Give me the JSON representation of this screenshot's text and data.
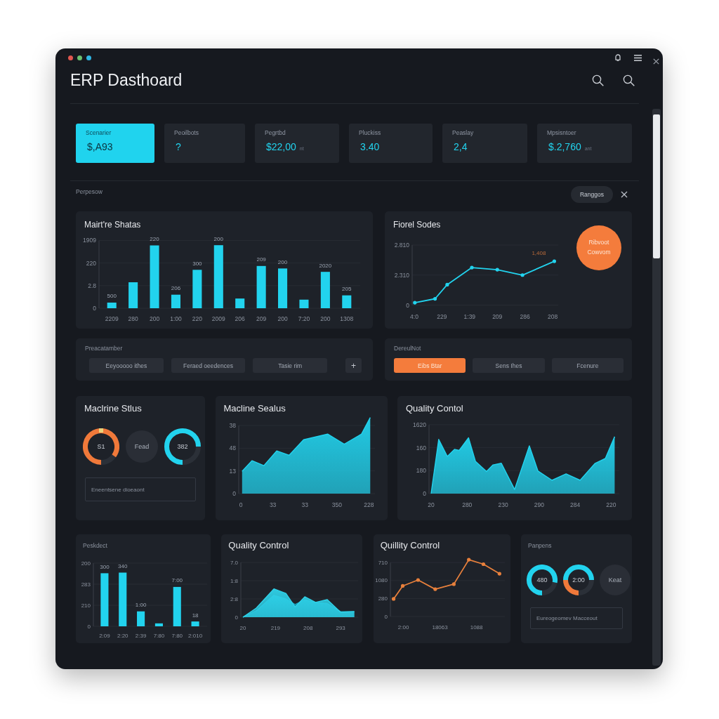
{
  "window": {
    "title": "ERP Dasthoard"
  },
  "kpi_cards": [
    {
      "label": "Scenarier",
      "value": "$,A93",
      "selected": true
    },
    {
      "label": "Peoilbots",
      "value": "?",
      "selected": false
    },
    {
      "label": "Pegrtbd",
      "value": "$22,00",
      "unit": "nt",
      "selected": false
    },
    {
      "label": "Pluckiss",
      "value": "3.40",
      "selected": false
    },
    {
      "label": "Peaslay",
      "value": "2,4",
      "selected": false
    },
    {
      "label": "Mpsisntoer",
      "value": "$.2,760",
      "unit": "ant",
      "selected": false
    }
  ],
  "section": {
    "label": "Perpesow",
    "button": "Ranggos"
  },
  "rows": [
    [
      {
        "kind": "chart",
        "title": "Mairt're Shatas",
        "chart": {
          "y_labels": [
            "1909",
            "220",
            "2.8",
            "0"
          ],
          "x_labels": [
            "2209",
            "280",
            "200",
            "1:00",
            "220",
            "2009",
            "206",
            "209",
            "200",
            "7:20",
            "200",
            "1308"
          ],
          "value_labels": [
            "500",
            "220",
            "206",
            "300",
            "200",
            "209",
            "200",
            "2020",
            "205"
          ]
        }
      },
      {
        "kind": "chart",
        "title": "Fiorel Sodes",
        "badge": "Ribvoot Cowvom",
        "chart": {
          "y_labels": [
            "2.810",
            "2.310",
            "0"
          ],
          "x_labels": [
            "4:0",
            "229",
            "1:39",
            "209",
            "286",
            "208"
          ],
          "annotation": "1,408"
        }
      }
    ],
    [
      {
        "kind": "buttons",
        "title": "Preacatamber",
        "buttons": [
          {
            "label": "Eeyooooo ithes"
          },
          {
            "label": "Feraed oeedences"
          },
          {
            "label": "Tasie rim"
          }
        ],
        "add_button": "+"
      },
      {
        "kind": "buttons",
        "title": "DereulNot",
        "buttons": [
          {
            "label": "Eibs Btar",
            "selected": true
          },
          {
            "label": "Sens Ihes",
            "selected": false
          },
          {
            "label": "Fcenure",
            "selected": false
          }
        ]
      }
    ],
    [
      {
        "kind": "gauges",
        "title": "Maclrine Stlus",
        "gauges": [
          {
            "kind": "ring",
            "value": "S1"
          },
          {
            "kind": "disc",
            "value": "Fead"
          },
          {
            "kind": "ring",
            "value": "382"
          }
        ],
        "note": "Eneentsene dioeaont"
      },
      {
        "kind": "chart",
        "title": "Macline Sealus",
        "chart": {
          "y_labels": [
            "38",
            "48",
            "13",
            "0"
          ],
          "x_labels": [
            "0",
            "33",
            "33",
            "350",
            "228"
          ]
        }
      },
      {
        "kind": "chart",
        "title": "Quality Contol",
        "chart": {
          "y_labels": [
            "1620",
            "160",
            "180",
            "0"
          ],
          "x_labels": [
            "20",
            "280",
            "230",
            "290",
            "284",
            "220"
          ]
        }
      }
    ],
    [
      {
        "kind": "chart",
        "title": "Peskdect",
        "chart": {
          "y_labels": [
            "200",
            "283",
            "210",
            "0"
          ],
          "x_labels": [
            "2:09",
            "2:20",
            "2:39",
            "7:80",
            "7:80",
            "2:010"
          ],
          "value_labels": [
            "300",
            "340",
            "1:00",
            "7:00",
            "18"
          ]
        }
      },
      {
        "kind": "chart",
        "title": "Quality Control",
        "chart": {
          "y_labels": [
            "7.0",
            "1:8",
            "2:8",
            "0"
          ],
          "x_labels": [
            "20",
            "219",
            "208",
            "293"
          ]
        }
      },
      {
        "kind": "chart",
        "title": "Quillity Control",
        "chart": {
          "y_labels": [
            "710",
            "1080",
            "280",
            "0"
          ],
          "x_labels": [
            "2:00",
            "18063",
            "1088"
          ]
        }
      },
      {
        "kind": "gauges",
        "title": "Panpens",
        "gauges": [
          {
            "kind": "ring",
            "value": "480"
          },
          {
            "kind": "ring",
            "value": "2:00"
          },
          {
            "kind": "disc",
            "value": "Keat"
          }
        ],
        "note": "Eureogeomev Macceout"
      }
    ]
  ]
}
